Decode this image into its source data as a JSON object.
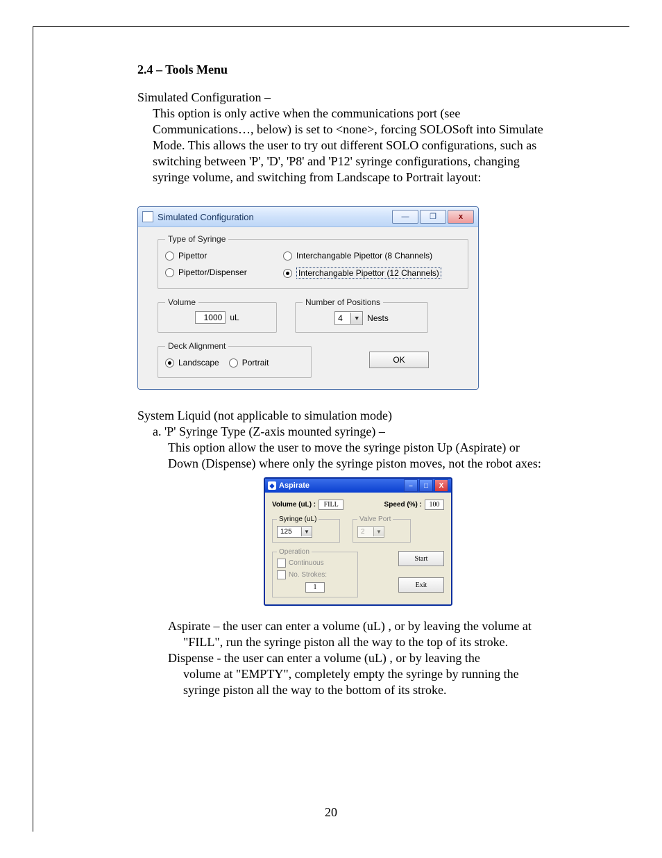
{
  "doc": {
    "heading": "2.4 – Tools Menu",
    "p1_line1": "Simulated Configuration –",
    "p1_line2": "This option is only active when the communications port (see",
    "p1_line3": "Communications…, below) is set to <none>, forcing SOLOSoft into Simulate",
    "p1_line4": "Mode.  This allows the user to try out different SOLO configurations, such as",
    "p1_line5": "switching between 'P', 'D', 'P8' and 'P12' syringe configurations, changing",
    "p1_line6": "syringe volume, and switching from Landscape to Portrait layout:",
    "p2_line1": "System Liquid (not applicable to simulation mode)",
    "p2_line2": "a. 'P' Syringe Type (Z-axis mounted syringe) –",
    "p2_line3": "This option allow the user to move the syringe piston Up (Aspirate) or",
    "p2_line4": "Down (Dispense) where only the syringe piston moves, not the robot axes:",
    "p3_line1": "Aspirate – the user can enter a volume (uL) , or by leaving the volume at",
    "p3_line2": "\"FILL\", run the syringe piston all the way to the top of its stroke.",
    "p3_line3": "Dispense - the user can enter a volume (uL) , or by leaving the",
    "p3_line4": "volume at \"EMPTY\", completely empty the syringe by running the",
    "p3_line5": "syringe piston all the way to the bottom of its stroke.",
    "page_number": "20"
  },
  "sim": {
    "title": "Simulated Configuration",
    "type_legend": "Type of Syringe",
    "opt_pipettor": "Pipettor",
    "opt_pd": "Pipettor/Dispenser",
    "opt_ip8": "Interchangable Pipettor (8 Channels)",
    "opt_ip12": "Interchangable Pipettor (12 Channels)",
    "volume_legend": "Volume",
    "volume_value": "1000",
    "volume_unit": "uL",
    "positions_legend": "Number of Positions",
    "positions_value": "4",
    "positions_unit": "Nests",
    "deck_legend": "Deck Alignment",
    "deck_landscape": "Landscape",
    "deck_portrait": "Portrait",
    "ok": "OK",
    "wmin": "—",
    "wmax": "❐",
    "wclose": "x"
  },
  "asp": {
    "title": "Aspirate",
    "vol_label": "Volume (uL) :",
    "vol_value": "FILL",
    "speed_label": "Speed (%) :",
    "speed_value": "100",
    "syringe_legend": "Syringe (uL)",
    "syringe_value": "125",
    "valve_legend": "Valve Port",
    "valve_value": "2",
    "op_legend": "Operation",
    "op_continuous": "Continuous",
    "op_strokes_lbl": "No. Strokes:",
    "op_strokes_val": "1",
    "start": "Start",
    "exit": "Exit",
    "wmin": "–",
    "wmax": "□",
    "wclose": "X"
  }
}
